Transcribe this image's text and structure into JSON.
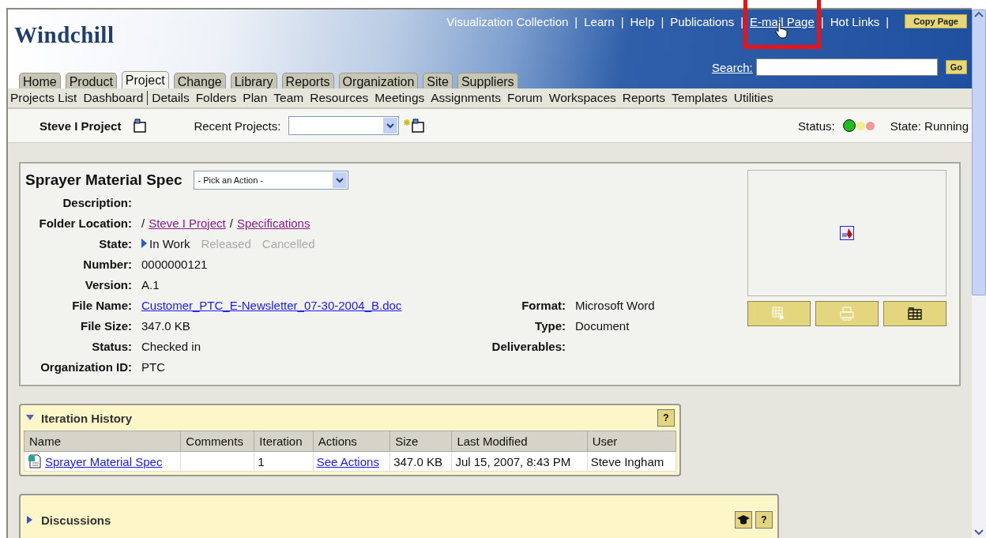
{
  "header": {
    "logo": "Windchill",
    "top_links": [
      {
        "kind": "link",
        "text": "Visualization Collection"
      },
      {
        "kind": "separator",
        "text": "|"
      },
      {
        "kind": "link",
        "text": "Learn"
      },
      {
        "kind": "separator",
        "text": "|"
      },
      {
        "kind": "link",
        "text": "Help"
      },
      {
        "kind": "separator",
        "text": "|"
      },
      {
        "kind": "link",
        "text": "Publications"
      },
      {
        "kind": "separator",
        "text": "|"
      },
      {
        "kind": "highlighted_link",
        "text": "E-mail Page"
      },
      {
        "kind": "separator",
        "text": "|"
      },
      {
        "kind": "link",
        "text": "Hot Links"
      },
      {
        "kind": "separator",
        "text": "|"
      }
    ],
    "copy_button": "Copy Page",
    "search_label": "Search:",
    "go_button": "Go",
    "tabs": [
      {
        "label": "Home",
        "selected": false
      },
      {
        "label": "Product",
        "selected": false
      },
      {
        "label": "Project",
        "selected": true
      },
      {
        "label": "Change",
        "selected": false
      },
      {
        "label": "Library",
        "selected": false
      },
      {
        "label": "Reports",
        "selected": false
      },
      {
        "label": "Organization",
        "selected": false
      },
      {
        "label": "Site",
        "selected": false
      },
      {
        "label": "Suppliers",
        "selected": false
      }
    ]
  },
  "subnav": [
    {
      "kind": "link",
      "label": "Projects List"
    },
    {
      "kind": "link",
      "label": "Dashboard"
    },
    {
      "kind": "divider"
    },
    {
      "kind": "link",
      "label": "Details"
    },
    {
      "kind": "link",
      "label": "Folders"
    },
    {
      "kind": "link",
      "label": "Plan"
    },
    {
      "kind": "link",
      "label": "Team"
    },
    {
      "kind": "link",
      "label": "Resources"
    },
    {
      "kind": "link",
      "label": "Meetings"
    },
    {
      "kind": "link",
      "label": "Assignments"
    },
    {
      "kind": "link",
      "label": "Forum"
    },
    {
      "kind": "link",
      "label": "Workspaces"
    },
    {
      "kind": "link",
      "label": "Reports"
    },
    {
      "kind": "link",
      "label": "Templates"
    },
    {
      "kind": "link",
      "label": "Utilities"
    }
  ],
  "project_bar": {
    "project": "Steve I Project",
    "recent_label": "Recent Projects:",
    "status_label": "Status:",
    "lights": [
      {
        "color": "#22bb22",
        "on": true
      },
      {
        "color": "#f0f08c",
        "on": false
      },
      {
        "color": "#f09a9a",
        "on": false
      }
    ],
    "state": "State: Running"
  },
  "details": {
    "title": "Sprayer Material Spec",
    "action": "- Pick an Action -",
    "fields": [
      {
        "kind": "text",
        "label": "Description:"
      },
      {
        "kind": "path",
        "label": "Folder Location:",
        "parts": [
          {
            "kind": "separator",
            "text": "/"
          },
          {
            "kind": "link",
            "text": "Steve I Project"
          },
          {
            "kind": "separator",
            "text": "/"
          },
          {
            "kind": "link",
            "text": "Specifications"
          }
        ]
      },
      {
        "kind": "states",
        "label": "State:",
        "states": [
          {
            "label": "In Work",
            "selected": true
          },
          {
            "label": "Released",
            "selected": false
          },
          {
            "label": "Cancelled",
            "selected": false
          }
        ]
      },
      {
        "kind": "text",
        "label": "Number:",
        "value": "0000000121"
      },
      {
        "kind": "text",
        "label": "Version:",
        "value": "A.1"
      },
      {
        "kind": "link",
        "label": "File Name:",
        "value": "Customer_PTC_E-Newsletter_07-30-2004_B.doc"
      },
      {
        "kind": "text",
        "label": "File Size:",
        "value": "347.0 KB"
      },
      {
        "kind": "text",
        "label": "Status:",
        "value": "Checked in"
      },
      {
        "kind": "text",
        "label": "Organization ID:",
        "value": "PTC"
      }
    ],
    "side_fields": [
      {
        "label": "Format:",
        "value": "Microsoft Word"
      },
      {
        "label": "Type:",
        "value": "Document"
      },
      {
        "label": "Deliverables:"
      }
    ]
  },
  "iteration_history": {
    "title": "Iteration History",
    "expanded": true,
    "help": "?",
    "columns": [
      "Name",
      "Comments",
      "Iteration",
      "Actions",
      "Size",
      "Last Modified",
      "User"
    ],
    "rows": [
      {
        "name": "Sprayer Material Spec",
        "comments": "",
        "iteration": "1",
        "actions": "See Actions",
        "size": "347.0 KB",
        "modified": "Jul 15, 2007, 8:43 PM",
        "user": "Steve Ingham"
      }
    ]
  },
  "discussions": {
    "title": "Discussions",
    "expanded": false,
    "help": "?"
  }
}
